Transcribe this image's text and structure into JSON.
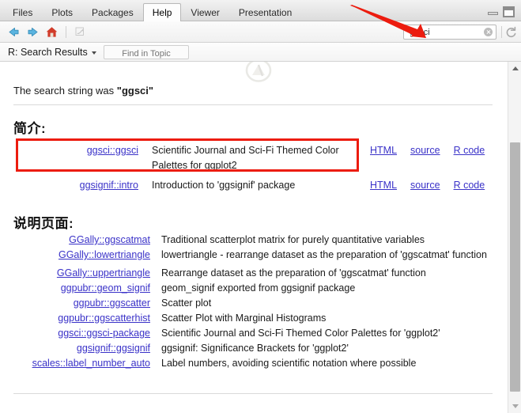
{
  "window": {
    "tabs": [
      {
        "label": "Files",
        "active": false
      },
      {
        "label": "Plots",
        "active": false
      },
      {
        "label": "Packages",
        "active": false
      },
      {
        "label": "Help",
        "active": true
      },
      {
        "label": "Viewer",
        "active": false
      },
      {
        "label": "Presentation",
        "active": false
      }
    ],
    "controls": {
      "minimize": "minimize-icon",
      "maximize": "maximize-icon"
    }
  },
  "toolbar": {
    "back": "back-arrow-icon",
    "forward": "forward-arrow-icon",
    "home": "home-icon",
    "print": "print-icon",
    "refresh": "refresh-icon",
    "search": {
      "value": "ggsci",
      "placeholder": "",
      "clear": "clear-icon"
    }
  },
  "subbar": {
    "topic_selector": "R: Search Results",
    "find_in_topic_placeholder": "Find in Topic",
    "find_in_topic_value": ""
  },
  "content": {
    "logo": "r-logo-icon",
    "search_string_prefix": "The search string was ",
    "search_string_value": "\"ggsci\"",
    "heading_vignettes": "简介:",
    "heading_help_pages": "说明页面:",
    "action_labels": {
      "html": "HTML",
      "source": "source",
      "rcode": "R code"
    },
    "vignettes": [
      {
        "link": "ggsci::ggsci",
        "desc": "Scientific Journal and Sci-Fi Themed Color Palettes for ggplot2",
        "actions": [
          "HTML",
          "source",
          "R code"
        ],
        "highlighted": true
      },
      {
        "link": "ggsignif::intro",
        "desc": "Introduction to 'ggsignif' package",
        "actions": [
          "HTML",
          "source",
          "R code"
        ],
        "highlighted": false
      }
    ],
    "help_pages": [
      {
        "link": "GGally::ggscatmat",
        "desc": "Traditional scatterplot matrix for purely quantitative variables"
      },
      {
        "link": "GGally::lowertriangle",
        "desc": "lowertriangle - rearrange dataset as the preparation of 'ggscatmat' function"
      },
      {
        "link": "GGally::uppertriangle",
        "desc": "Rearrange dataset as the preparation of 'ggscatmat' function"
      },
      {
        "link": "ggpubr::geom_signif",
        "desc": "geom_signif exported from ggsignif package"
      },
      {
        "link": "ggpubr::ggscatter",
        "desc": "Scatter plot"
      },
      {
        "link": "ggpubr::ggscatterhist",
        "desc": "Scatter Plot with Marginal Histograms"
      },
      {
        "link": "ggsci::ggsci-package",
        "desc": "Scientific Journal and Sci-Fi Themed Color Palettes for 'ggplot2'"
      },
      {
        "link": "ggsignif::ggsignif",
        "desc": "ggsignif: Significance Brackets for 'ggplot2'"
      },
      {
        "link": "scales::label_number_auto",
        "desc": "Label numbers, avoiding scientific notation where possible"
      }
    ]
  },
  "scrollbar": {
    "up": "scroll-up-arrow-icon",
    "down": "scroll-down-arrow-icon"
  },
  "annotations": {
    "highlight_box_color": "#ec1c0f",
    "arrow_color": "#ec1c0f",
    "arrow_target": "search-input"
  },
  "colors": {
    "link": "#3a32c8",
    "accent_red": "#ec1c0f",
    "chrome": "#e6e6e6",
    "content_bg": "#ffffff"
  }
}
